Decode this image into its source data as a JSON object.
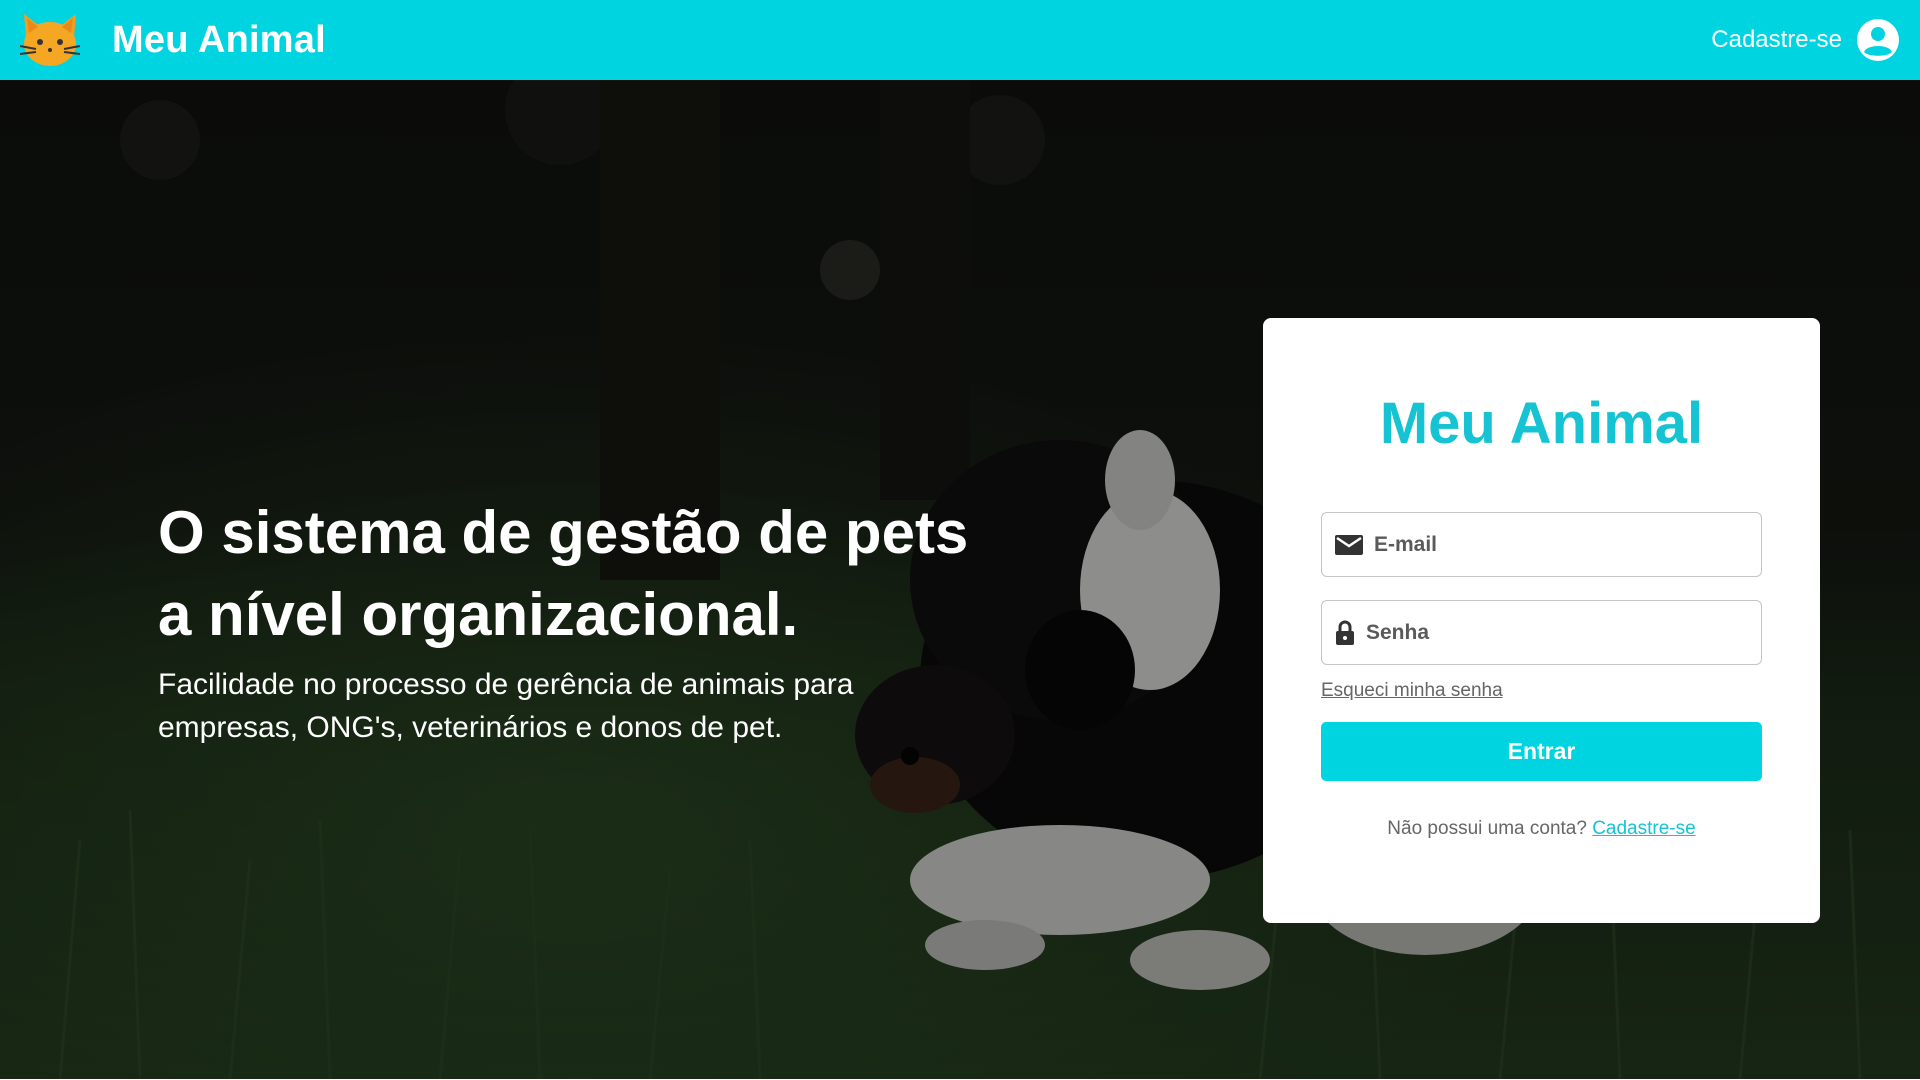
{
  "header": {
    "brand_name": "Meu Animal",
    "logo_icon": "cat-face-icon",
    "signup_label": "Cadastre-se",
    "account_icon": "account-circle-icon"
  },
  "hero": {
    "headline_line1": "O sistema de gestão de pets",
    "headline_line2": "a nível organizacional.",
    "subheadline_line1": "Facilidade no processo de gerência de animais para",
    "subheadline_line2": "empresas, ONG's, veterinários e donos de pet.",
    "background": "puppy-on-grass-photo"
  },
  "login": {
    "title": "Meu Animal",
    "email_placeholder": "E-mail",
    "email_icon": "mail-icon",
    "password_placeholder": "Senha",
    "password_icon": "lock-icon",
    "forgot_label": "Esqueci minha senha",
    "submit_label": "Entrar",
    "no_account_text": "Não possui uma conta?",
    "signup_link": "Cadastre-se"
  },
  "colors": {
    "accent": "#00d4e1",
    "title_accent": "#16c3d2"
  }
}
